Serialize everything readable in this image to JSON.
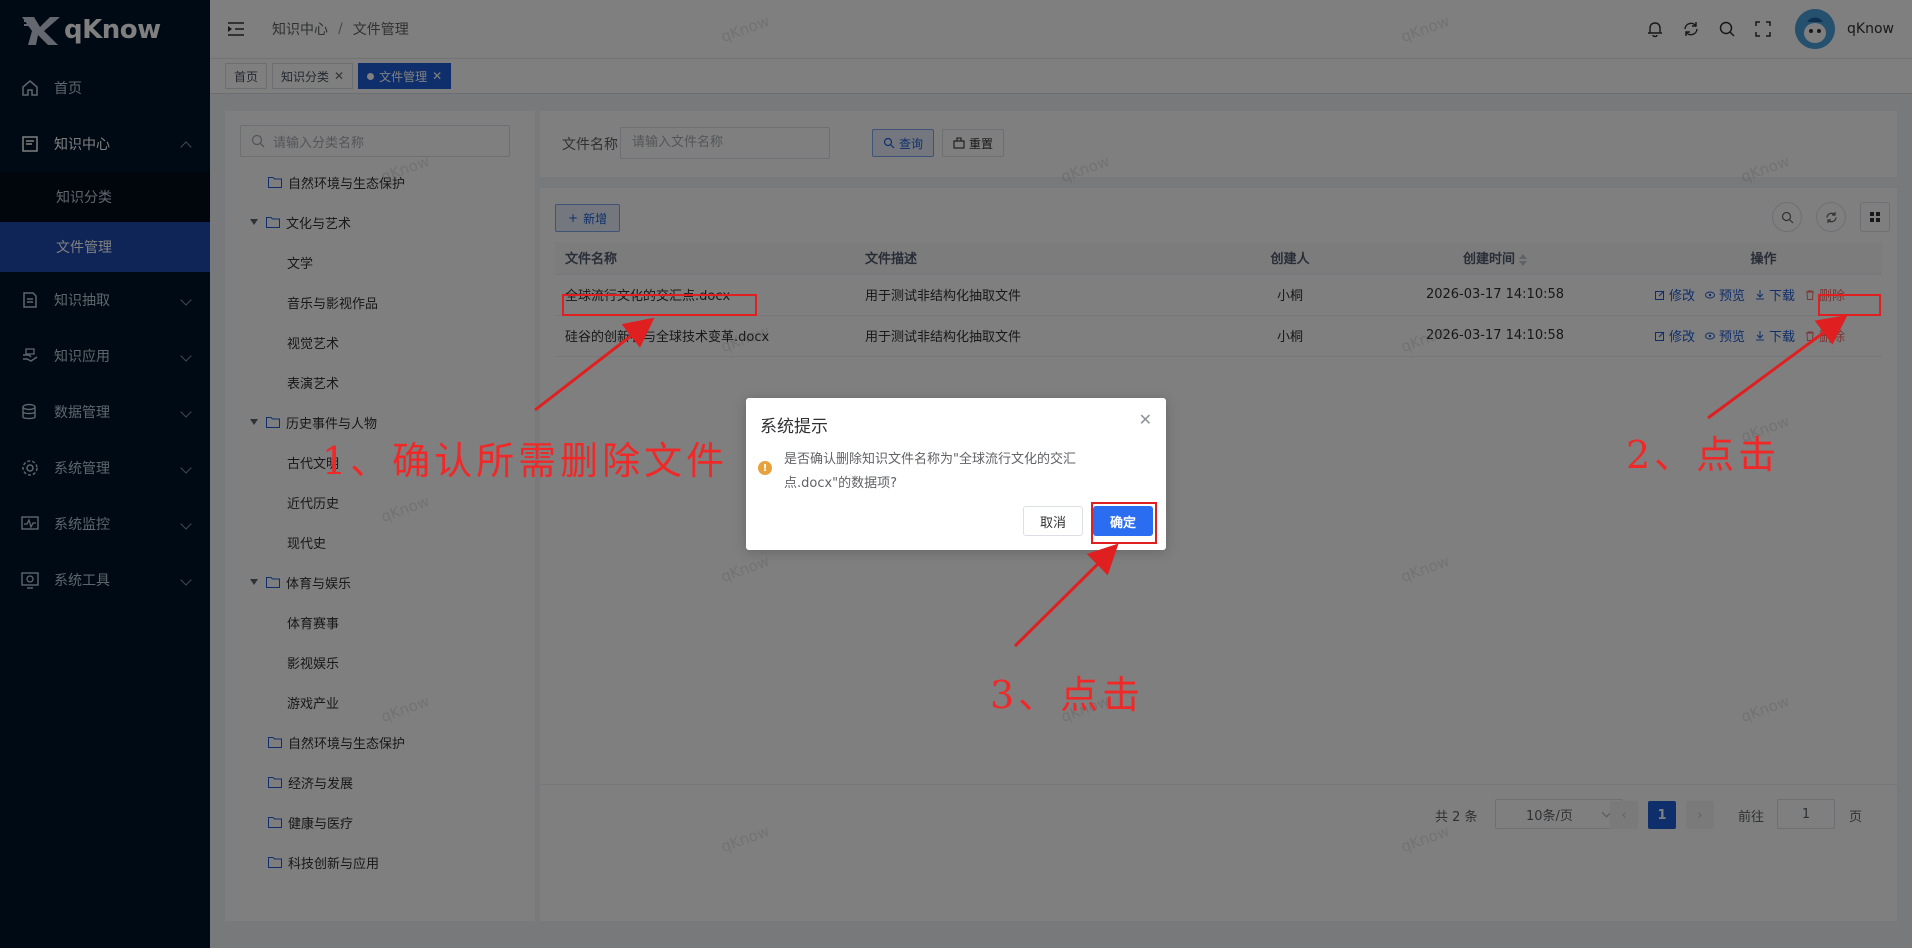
{
  "app": {
    "name": "qKnow"
  },
  "sidebar": {
    "items": [
      {
        "label": "首页",
        "icon": "home-icon"
      },
      {
        "label": "知识中心",
        "icon": "book-icon",
        "open": true,
        "children": [
          {
            "label": "知识分类"
          },
          {
            "label": "文件管理",
            "active": true
          }
        ]
      },
      {
        "label": "知识抽取",
        "icon": "extract-icon"
      },
      {
        "label": "知识应用",
        "icon": "hand-icon"
      },
      {
        "label": "数据管理",
        "icon": "database-icon"
      },
      {
        "label": "系统管理",
        "icon": "gear-icon"
      },
      {
        "label": "系统监控",
        "icon": "monitor-icon"
      },
      {
        "label": "系统工具",
        "icon": "tools-icon"
      }
    ]
  },
  "header": {
    "breadcrumb": [
      "知识中心",
      "文件管理"
    ],
    "username": "qKnow"
  },
  "tags": [
    {
      "label": "首页"
    },
    {
      "label": "知识分类"
    },
    {
      "label": "文件管理",
      "active": true
    }
  ],
  "tree": {
    "search_placeholder": "请输入分类名称",
    "nodes": [
      "自然环境与生态保护",
      "文化与艺术",
      "文学",
      "音乐与影视作品",
      "视觉艺术",
      "表演艺术",
      "历史事件与人物",
      "古代文明",
      "近代历史",
      "现代史",
      "体育与娱乐",
      "体育赛事",
      "影视娱乐",
      "游戏产业",
      "自然环境与生态保护",
      "经济与发展",
      "健康与医疗",
      "科技创新与应用"
    ]
  },
  "search": {
    "label": "文件名称",
    "placeholder": "请输入文件名称",
    "query_label": "查询",
    "reset_label": "重置"
  },
  "toolbar": {
    "add_label": "新增"
  },
  "table": {
    "headers": [
      "文件名称",
      "文件描述",
      "创建人",
      "创建时间",
      "操作"
    ],
    "rows": [
      {
        "name": "全球流行文化的交汇点.docx",
        "desc": "用于测试非结构化抽取文件",
        "creator": "小桐",
        "time": "2026-03-17 14:10:58"
      },
      {
        "name": "硅谷的创新者与全球技术变革.docx",
        "desc": "用于测试非结构化抽取文件",
        "creator": "小桐",
        "time": "2026-03-17 14:10:58"
      }
    ],
    "ops": [
      "修改",
      "预览",
      "下载",
      "删除"
    ]
  },
  "pagination": {
    "total": "共 2 条",
    "page_size": "10条/页",
    "current": "1",
    "goto_label": "前往",
    "goto_value": "1",
    "page_suffix": "页"
  },
  "dialog": {
    "title": "系统提示",
    "message": "是否确认删除知识文件名称为\"全球流行文化的交汇点.docx\"的数据项?",
    "cancel": "取消",
    "confirm": "确定"
  },
  "annotations": {
    "step1": "1、确认所需删除文件",
    "step2": "2、点击",
    "step3": "3、点击",
    "color": "#f02828"
  },
  "watermark": "qKnow",
  "colors": {
    "sidebar_bg": "#001529",
    "primary": "#1f5fd9",
    "danger": "#f56c6c"
  }
}
